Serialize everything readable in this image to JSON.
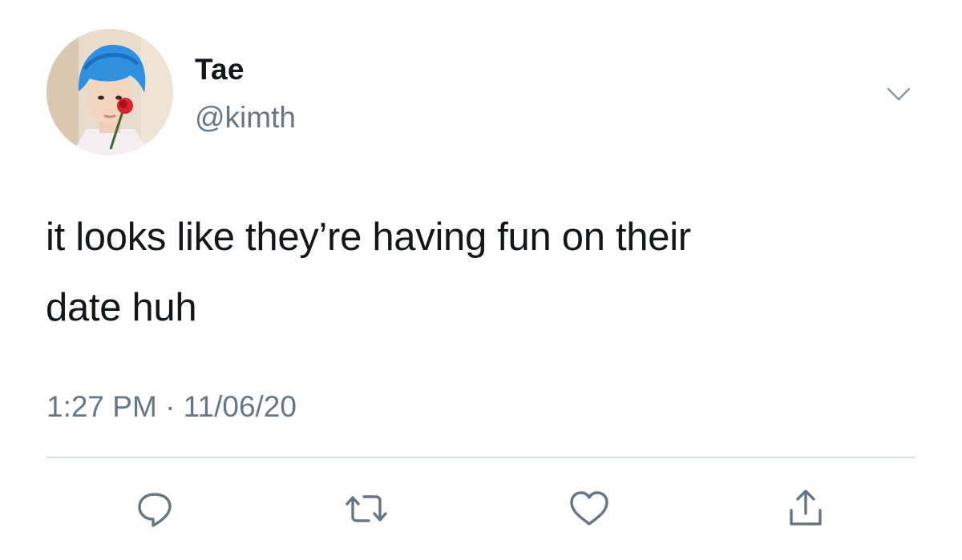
{
  "tweet": {
    "display_name": "Tae",
    "handle": "@kimth",
    "text_lines": [
      "it looks like they’re having fun on their",
      "date huh"
    ],
    "timestamp": "1:27 PM · 11/06/20"
  },
  "icons": {
    "avatar": "profile-photo",
    "more": "chevron-down-icon",
    "actions": [
      "reply-icon",
      "retweet-icon",
      "like-icon",
      "share-icon"
    ]
  },
  "colors": {
    "text": "#14171a",
    "secondary": "#657786",
    "divider": "#d9dee2",
    "icon": "#657786",
    "avatar_hair": "#2f8fe0"
  }
}
